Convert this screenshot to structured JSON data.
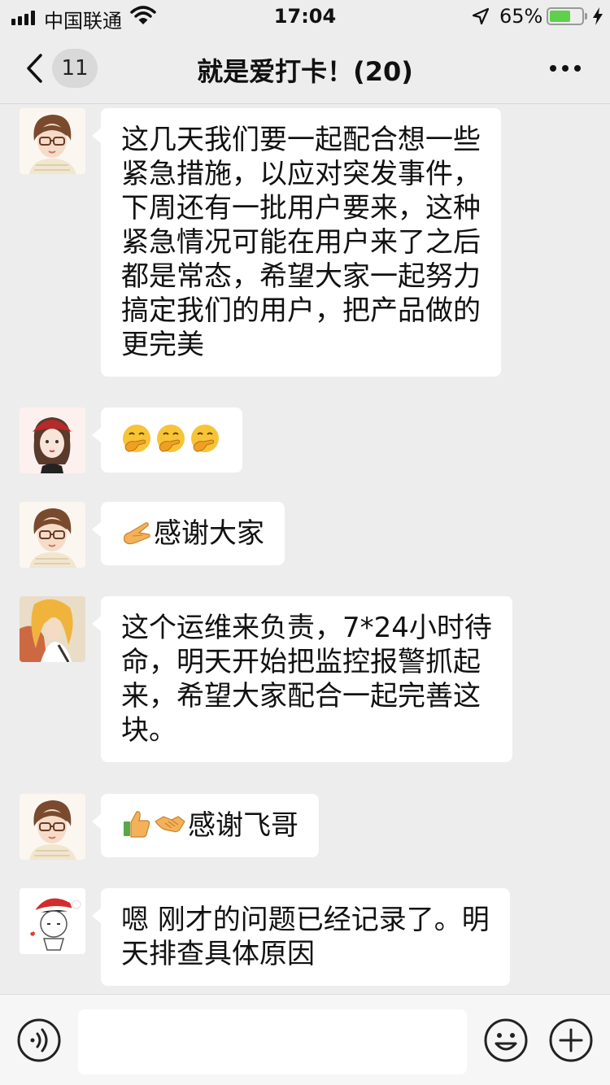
{
  "status_bar": {
    "carrier": "中国联通",
    "time": "17:04",
    "battery_percent": "65%",
    "battery_level": 0.65
  },
  "nav": {
    "back_unread": "11",
    "title": "就是爱打卡！(20)"
  },
  "messages": [
    {
      "avatar": "avatar-woman-glasses",
      "lines": [
        "这几天我们要一起配合想一些",
        "紧急措施，以应对突发事件，",
        "下周还有一批用户要来，这种",
        "紧急情况可能在用户来了之后",
        "都是常态，希望大家一起努力",
        "搞定我们的用户，把产品做的",
        "更完美"
      ]
    },
    {
      "avatar": "avatar-girl-red-hat",
      "emojis": [
        "hand-over-mouth-emoji",
        "hand-over-mouth-emoji",
        "hand-over-mouth-emoji"
      ]
    },
    {
      "avatar": "avatar-woman-glasses",
      "emoji": "pinched-fingers-emoji",
      "text": "感谢大家"
    },
    {
      "avatar": "avatar-anime-character",
      "lines": [
        "这个运维来负责，7*24小时待",
        "命，明天开始把监控报警抓起",
        "来，希望大家配合一起完善这",
        "块。"
      ]
    },
    {
      "avatar": "avatar-woman-glasses",
      "emojis": [
        "thumbs-up-emoji",
        "handshake-emoji"
      ],
      "text": "感谢飞哥"
    },
    {
      "avatar": "avatar-santa-hat-sketch",
      "lines": [
        "嗯 刚才的问题已经记录了。明",
        "天排查具体原因"
      ]
    }
  ],
  "colors": {
    "background": "#ededed",
    "bubble": "#ffffff",
    "battery": "#5fd04b"
  }
}
